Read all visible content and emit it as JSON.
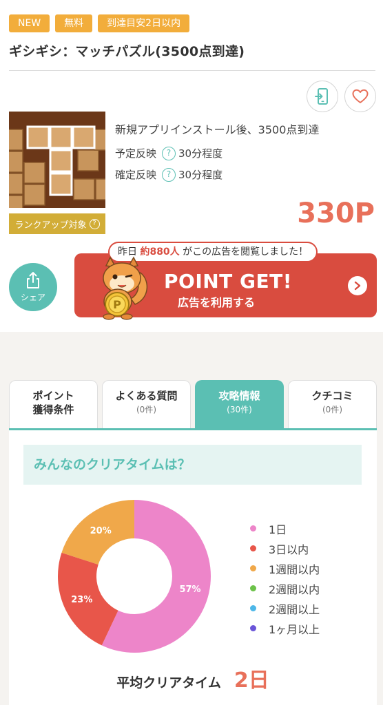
{
  "tags": [
    "NEW",
    "無料",
    "到達目安2日以内"
  ],
  "title": "ギシギシ：マッチパズル(3500点到達)",
  "offer": {
    "description": "新規アプリインストール後、3500点到達",
    "scheduled_label": "予定反映",
    "scheduled_value": "30分程度",
    "confirmed_label": "確定反映",
    "confirmed_value": "30分程度",
    "points": "330P",
    "rank_badge": "ランクアップ対象",
    "help_glyph": "?"
  },
  "share": {
    "label": "シェア",
    "icon": "share-icon"
  },
  "cta": {
    "bubble_prefix": "昨日 ",
    "bubble_count": "約880人",
    "bubble_suffix": " がこの広告を閲覧しました！",
    "main": "POINT GET!",
    "sub": "広告を利用する"
  },
  "tabs": [
    {
      "line1": "ポイント",
      "line2": "獲得条件",
      "active": false
    },
    {
      "line1": "よくある質問",
      "line2": "(0件)",
      "active": false
    },
    {
      "line1": "攻略情報",
      "line2": "(30件)",
      "active": true
    },
    {
      "line1": "クチコミ",
      "line2": "(0件)",
      "active": false
    }
  ],
  "clear_time": {
    "heading": "みんなのクリアタイムは？",
    "average_label": "平均クリアタイム",
    "average_value": "2日"
  },
  "chart_data": {
    "type": "pie",
    "categories": [
      "1日",
      "3日以内",
      "1週間以内",
      "2週間以内",
      "2週間以上",
      "1ヶ月以上"
    ],
    "values": [
      57,
      23,
      20,
      0,
      0,
      0
    ],
    "slice_labels": [
      "57%",
      "23%",
      "20%",
      "",
      "",
      ""
    ],
    "colors": [
      "#ed85c9",
      "#e8564a",
      "#f0a84a",
      "#6cc24a",
      "#4db7e8",
      "#6a55d8"
    ],
    "legend_position": "right",
    "donut": true
  },
  "colors": {
    "accent": "#5bbfb3",
    "tag": "#f2ad3b",
    "points": "#e8705a",
    "cta": "#d94c3f",
    "rank_badge": "#d2ad37"
  }
}
